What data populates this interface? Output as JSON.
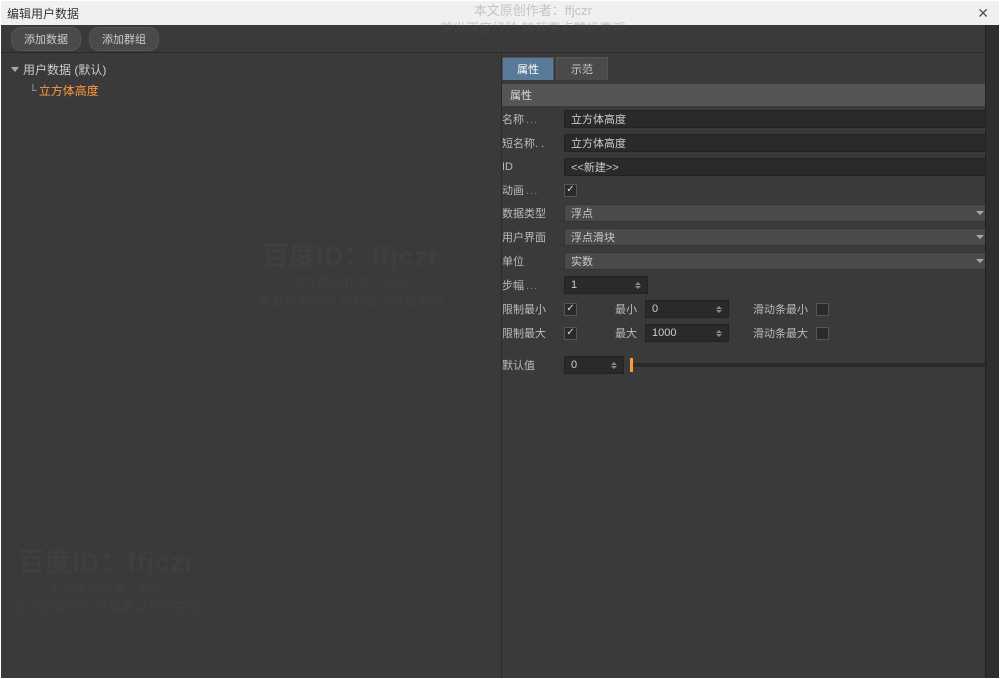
{
  "titlebar": {
    "title": "编辑用户数据"
  },
  "toolbar": {
    "add_data": "添加数据",
    "add_group": "添加群组"
  },
  "tree": {
    "root": "用户数据 (默认)",
    "child": "立方体高度"
  },
  "tabs": {
    "attributes": "属性",
    "example": "示范"
  },
  "section": {
    "header": "属性"
  },
  "form": {
    "name_label": "名称",
    "name_value": "立方体高度",
    "shortname_label": "短名称",
    "shortname_value": "立方体高度",
    "id_label": "ID",
    "id_value": "<<新建>>",
    "anim_label": "动画",
    "anim_checked": true,
    "datatype_label": "数据类型",
    "datatype_value": "浮点",
    "ui_label": "用户界面",
    "ui_value": "浮点滑块",
    "unit_label": "单位",
    "unit_value": "实数",
    "step_label": "步幅",
    "step_value": "1",
    "limit_min_label": "限制最小",
    "limit_min_checked": true,
    "min_label": "最小",
    "min_value": "0",
    "slider_min_label": "滑动条最小",
    "slider_min_checked": false,
    "limit_max_label": "限制最大",
    "limit_max_checked": true,
    "max_label": "最大",
    "max_value": "1000",
    "slider_max_label": "滑动条最大",
    "slider_max_checked": false,
    "default_label": "默认值",
    "default_value": "0"
  },
  "watermarks": {
    "id_line": "百度ID：ffjczr",
    "author_line": "本文原创作者：ffjczr",
    "repost_line": "首发百度经验 转载要点赞投票哦"
  }
}
